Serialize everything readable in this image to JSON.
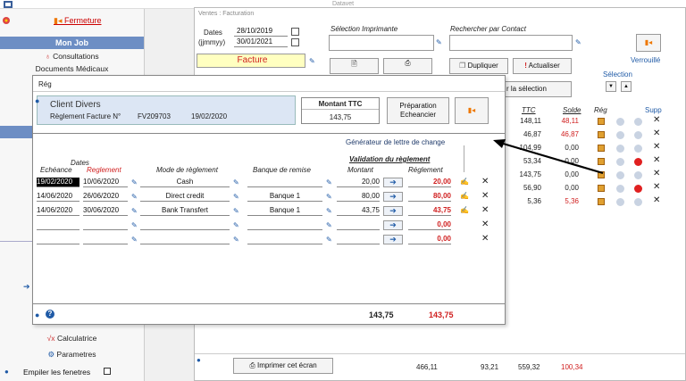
{
  "app_title": "Datavet",
  "sidebar": {
    "fermeture": "Fermeture",
    "section": "Mon Job",
    "items": [
      "Consultations",
      "Documents Médicaux"
    ],
    "bottom_items": [
      "Calculatrice",
      "Parametres"
    ],
    "empiler": "Empiler les fenetres"
  },
  "facturation": {
    "title": "Ventes : Facturation",
    "dates_label": "Dates",
    "dates_format": "(jjmmyy)",
    "date_from": "28/10/2019",
    "date_to": "30/01/2021",
    "doc_type": "Facture",
    "imprimante_label": "Sélection Imprimante",
    "contact_label": "Rechercher par  Contact",
    "dupliquer": "Dupliquer",
    "actualiser": "Actualiser",
    "selection_btn": "r la sélection",
    "verrouille": "Verrouillé",
    "selection": "Sélection",
    "col_ttc": "TTC",
    "col_solde": "Solde",
    "col_reg": "Rég",
    "col_supp": "Supp",
    "rows": [
      {
        "ttc": "148,11",
        "solde": "48,11",
        "red": true,
        "lock": false
      },
      {
        "ttc": "46,87",
        "solde": "46,87",
        "red": true,
        "lock": false
      },
      {
        "ttc": "104,99",
        "solde": "0,00",
        "red": false,
        "lock": false
      },
      {
        "ttc": "53,34",
        "solde": "0,00",
        "red": false,
        "lock": true
      },
      {
        "ttc": "143,75",
        "solde": "0,00",
        "red": false,
        "lock": false
      },
      {
        "ttc": "56,90",
        "solde": "0,00",
        "red": false,
        "lock": true
      },
      {
        "ttc": "5,36",
        "solde": "5,36",
        "red": true,
        "lock": false
      }
    ],
    "print_btn": "Imprimer cet écran",
    "totals": [
      "466,11",
      "93,21",
      "559,32",
      "100,34"
    ]
  },
  "reg": {
    "title": "Rég",
    "client": "Client Divers",
    "reglement_label": "Règlement Facture N°",
    "facture_no": "FV209703",
    "facture_date": "19/02/2020",
    "montant_label": "Montant TTC",
    "montant_value": "143,75",
    "preparation": "Préparation",
    "echeancier": "Echeancier",
    "dates_hdr": "Dates",
    "echeance_hdr": "Echéance",
    "reglement_hdr": "Reglement",
    "mode_hdr": "Mode de règlement",
    "banque_hdr": "Banque de remise",
    "validation_hdr": "Validation du règlement",
    "montant_hdr": "Montant",
    "reglement_col_hdr": "Réglement",
    "generateur": "Générateur de lettre de change",
    "rows": [
      {
        "echeance": "19/02/2020",
        "reglement": "10/06/2020",
        "mode": "Cash",
        "banque": "",
        "montant": "20,00",
        "regle": "20,00"
      },
      {
        "echeance": "14/06/2020",
        "reglement": "26/06/2020",
        "mode": "Direct credit",
        "banque": "Banque 1",
        "montant": "80,00",
        "regle": "80,00"
      },
      {
        "echeance": "14/06/2020",
        "reglement": "30/06/2020",
        "mode": "Bank Transfert",
        "banque": "Banque 1",
        "montant": "43,75",
        "regle": "43,75"
      },
      {
        "echeance": "",
        "reglement": "",
        "mode": "",
        "banque": "",
        "montant": "",
        "regle": "0,00"
      },
      {
        "echeance": "",
        "reglement": "",
        "mode": "",
        "banque": "",
        "montant": "",
        "regle": "0,00"
      }
    ],
    "total_montant": "143,75",
    "total_regle": "143,75"
  }
}
